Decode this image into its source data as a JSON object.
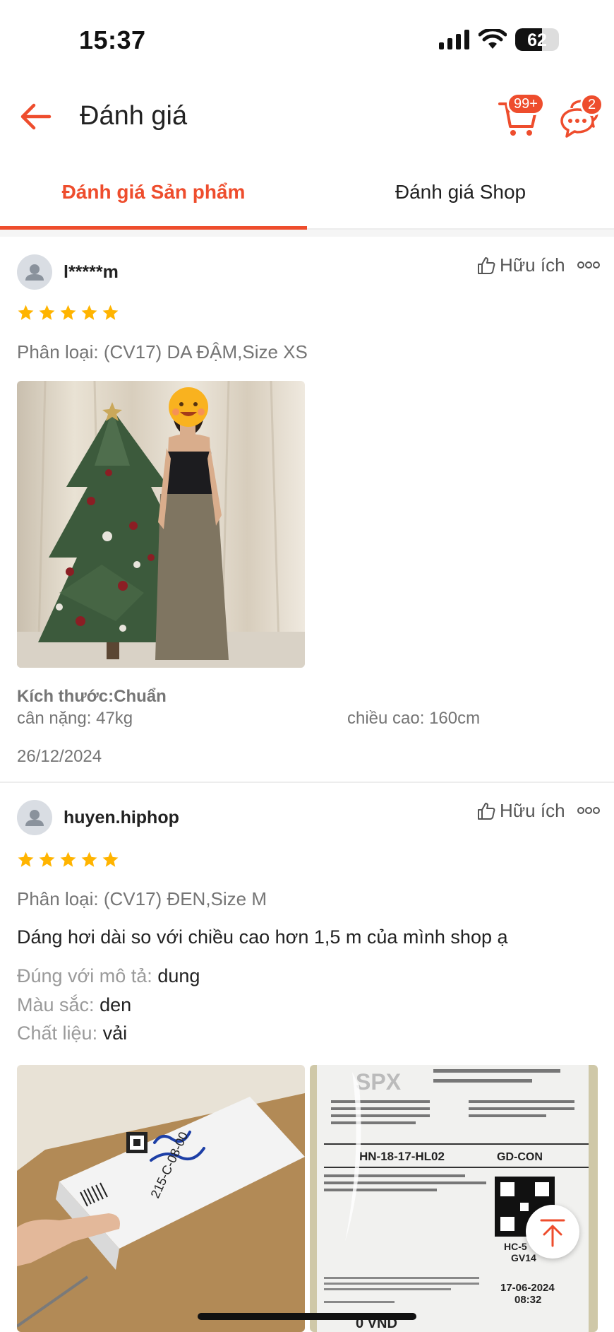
{
  "status": {
    "time": "15:37",
    "battery": "62",
    "battery_level": 0.62
  },
  "header": {
    "title": "Đánh giá",
    "cart_badge": "99+",
    "chat_badge": "2"
  },
  "tabs": [
    {
      "label": "Đánh giá Sản phẩm",
      "active": true
    },
    {
      "label": "Đánh giá Shop",
      "active": false
    }
  ],
  "reviews": [
    {
      "username": "l*****m",
      "helpful": "Hữu ích",
      "rating": 5,
      "variant": "Phân loại: (CV17) DA ĐẬM,Size XS",
      "fit_title": "Kích thước:Chuẩn",
      "weight": "cân nặng: 47kg",
      "height": "chiều cao: 160cm",
      "date": "26/12/2024"
    },
    {
      "username": "huyen.hiphop",
      "helpful": "Hữu ích",
      "rating": 5,
      "variant": "Phân loại: (CV17) ĐEN,Size M",
      "content": "Dáng hơi dài so với chiều cao hơn 1,5 m của mình shop ạ",
      "attrs": [
        {
          "label": "Đúng với mô tả:",
          "value": "dung"
        },
        {
          "label": "Màu sắc:",
          "value": "den"
        },
        {
          "label": "Chất liệu:",
          "value": "vải"
        }
      ],
      "label_photo": {
        "brand": "SPX",
        "route": "HN-18-17-HL02",
        "code": "GD-CON",
        "date": "17-06-2024",
        "time": "08:32",
        "price": "0 VND",
        "sort_code": "HC-5",
        "sort_code2": "GV14",
        "handwriting": "215-C-08-00"
      }
    }
  ],
  "colors": {
    "accent": "#ee4d2d",
    "star": "#ffb400"
  }
}
